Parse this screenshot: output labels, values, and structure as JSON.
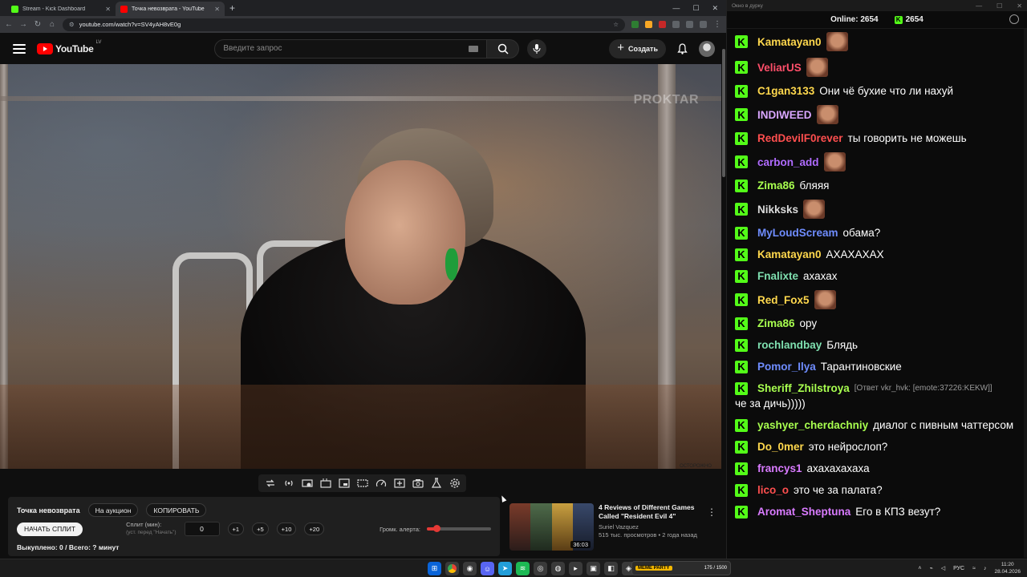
{
  "browser": {
    "tabs": [
      {
        "title": "Stream - Kick Dashboard",
        "active": false,
        "favicon_color": "#53fc18"
      },
      {
        "title": "Точка невозврата - YouTube",
        "active": true,
        "favicon_color": "#ff0000"
      }
    ],
    "url": "youtube.com/watch?v=SV4yAH8vE0g"
  },
  "youtube": {
    "logo_text": "YouTube",
    "logo_country": "LV",
    "search_placeholder": "Введите запрос",
    "create_label": "Создать",
    "video_watermark": "PROKTAR",
    "channel_mark": "ОСТОРОЖНО"
  },
  "auction": {
    "title": "Точка невозврата",
    "to_auction": "На аукцион",
    "copy": "КОПИРОВАТЬ",
    "start_split": "НАЧАТЬ СПЛИТ",
    "split_label": "Сплит (мин):",
    "split_hint": "(уст. перед \"Начать\")",
    "split_value": "0",
    "increments": [
      "+1",
      "+5",
      "+10",
      "+20"
    ],
    "volume_label": "Громк. алерта:",
    "volume_level_pct": 15,
    "bought": "Выкуплено: 0 / Всего: ? минут"
  },
  "recommended": {
    "title": "4 Reviews of Different Games Called \"Resident Evil 4\"",
    "channel": "Suriel Vazquez",
    "meta": "515 тыс. просмотров • 2 года назад",
    "duration": "36:03"
  },
  "chat": {
    "window_title": "Окно в дурку",
    "online_label": "Online:",
    "online_count": "2654",
    "kick_count": "2654",
    "messages": [
      {
        "user": "Kamatayan0",
        "color": "#ffd84d",
        "text": "",
        "emote": true
      },
      {
        "user": "VeliarUS",
        "color": "#ff4f6a",
        "text": "",
        "emote": true
      },
      {
        "user": "C1gan3133",
        "color": "#ffd84d",
        "text": "Они чё бухие что ли нахуй",
        "emote": false
      },
      {
        "user": "INDIWEED",
        "color": "#d9a6ff",
        "text": "",
        "emote": true
      },
      {
        "user": "RedDevilF0rever",
        "color": "#ff4f4f",
        "text": "ты говорить не можешь",
        "emote": false
      },
      {
        "user": "carbon_add",
        "color": "#b06bff",
        "text": "",
        "emote": true
      },
      {
        "user": "Zima86",
        "color": "#a8ff4f",
        "text": "бляяя",
        "emote": false
      },
      {
        "user": "Nikksks",
        "color": "#dcdcdc",
        "text": "",
        "emote": true
      },
      {
        "user": "MyLoudScream",
        "color": "#6f8dff",
        "text": "обама?",
        "emote": false
      },
      {
        "user": "Kamatayan0",
        "color": "#ffd84d",
        "text": "АХАХАХАХ",
        "emote": false
      },
      {
        "user": "Fnalixte",
        "color": "#7fe0b0",
        "text": "ахахах",
        "emote": false
      },
      {
        "user": "Red_Fox5",
        "color": "#ffd84d",
        "text": "",
        "emote": true
      },
      {
        "user": "Zima86",
        "color": "#a8ff4f",
        "text": "ору",
        "emote": false
      },
      {
        "user": "rochlandbay",
        "color": "#7fe0b0",
        "text": "Блядь",
        "emote": false
      },
      {
        "user": "Pomor_Ilya",
        "color": "#6f8dff",
        "text": "Тарантиновские",
        "emote": false
      },
      {
        "user": "Sheriff_Zhilstroya",
        "color": "#a8ff4f",
        "reply": "[Ответ vkr_hvk: [emote:37226:KEKW]]",
        "text": "че за дичь)))))",
        "emote": false
      },
      {
        "user": "yashyer_cherdachniy",
        "color": "#a8ff4f",
        "text": "диалог с пивным чаттерсом",
        "emote": false
      },
      {
        "user": "Do_0mer",
        "color": "#ffd84d",
        "text": "это нейрослоп?",
        "emote": false
      },
      {
        "user": "francys1",
        "color": "#d97bff",
        "text": "ахахахахаха",
        "emote": false
      },
      {
        "user": "lico_o",
        "color": "#ff4f4f",
        "text": "это че за палата?",
        "emote": false
      },
      {
        "user": "Aromat_Sheptuna",
        "color": "#d97bff",
        "text": "Его в КПЗ везут?",
        "emote": false
      }
    ]
  },
  "taskbar": {
    "widget_label": "MEME PARTY",
    "widget_value": "175 / 1500",
    "lang": "РУС",
    "time": "11:20",
    "date": "28.04.2026"
  }
}
